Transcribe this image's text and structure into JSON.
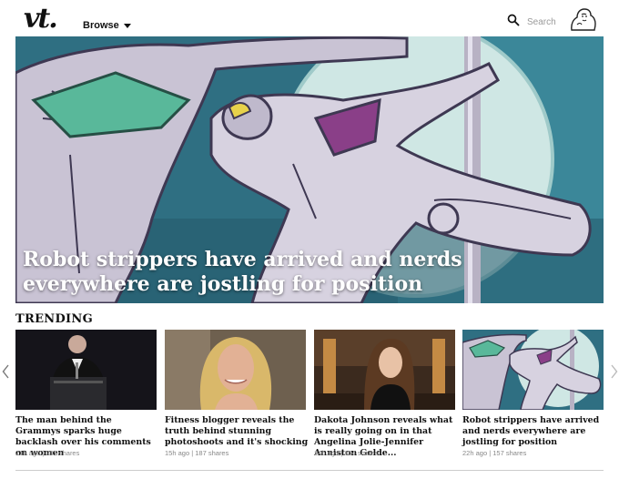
{
  "header": {
    "logo": "vt.",
    "browse_label": "Browse",
    "search_placeholder": "Search"
  },
  "hero": {
    "title": "Robot strippers have arrived and nerds everywhere are jostling for position"
  },
  "trending": {
    "heading": "TRENDING",
    "cards": [
      {
        "title": "The man behind the Grammys sparks huge backlash over his comments on women",
        "time": "21h ago",
        "shares": "207 shares"
      },
      {
        "title": "Fitness blogger reveals the truth behind stunning photoshoots and it's shocking",
        "time": "15h ago",
        "shares": "187 shares"
      },
      {
        "title": "Dakota Johnson reveals what is really going on in that Angelina Jolie-Jennifer Anniston Golde...",
        "time": "14h ago",
        "shares": "164 shares"
      },
      {
        "title": "Robot strippers have arrived and nerds everywhere are jostling for position",
        "time": "22h ago",
        "shares": "157 shares"
      }
    ]
  }
}
